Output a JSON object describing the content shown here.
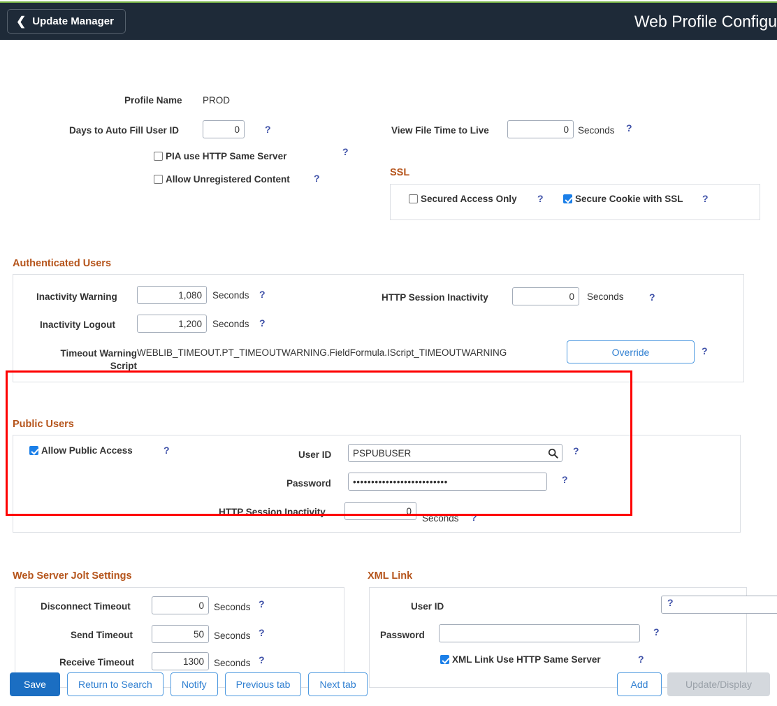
{
  "header": {
    "back_label": "Update Manager",
    "back_icon": "chevron-left-icon",
    "title": "Web Profile Configu"
  },
  "help_glyph": "?",
  "search_glyph": "search-icon",
  "top": {
    "profile_name_label": "Profile Name",
    "profile_name_value": "PROD",
    "days_autofill_label": "Days to Auto Fill User ID",
    "days_autofill_value": "0",
    "pia_http_same_server_label": "PIA use HTTP Same Server",
    "pia_http_same_server_checked": false,
    "allow_unregistered_label": "Allow Unregistered Content",
    "allow_unregistered_checked": false,
    "view_file_ttl_label": "View File Time to Live",
    "view_file_ttl_value": "0",
    "seconds": "Seconds"
  },
  "ssl": {
    "title": "SSL",
    "secured_access_only_label": "Secured Access Only",
    "secured_access_only_checked": false,
    "secure_cookie_label": "Secure Cookie with SSL",
    "secure_cookie_checked": true
  },
  "authenticated_users": {
    "title": "Authenticated Users",
    "inactivity_warning_label": "Inactivity Warning",
    "inactivity_warning_value": "1,080",
    "inactivity_logout_label": "Inactivity Logout",
    "inactivity_logout_value": "1,200",
    "timeout_warning_script_label": "Timeout Warning Script",
    "timeout_warning_script_value": "WEBLIB_TIMEOUT.PT_TIMEOUTWARNING.FieldFormula.IScript_TIMEOUTWARNING",
    "http_session_inactivity_label": "HTTP Session Inactivity",
    "http_session_inactivity_value": "0",
    "override_label": "Override",
    "seconds": "Seconds"
  },
  "public_users": {
    "title": "Public Users",
    "allow_public_access_label": "Allow Public Access",
    "allow_public_access_checked": true,
    "user_id_label": "User ID",
    "user_id_value": "PSPUBUSER",
    "password_label": "Password",
    "password_value": "••••••••••••••••••••••••••",
    "http_session_inactivity_label": "HTTP Session Inactivity",
    "http_session_inactivity_value": "0",
    "seconds": "Seconds"
  },
  "jolt": {
    "title": "Web Server Jolt Settings",
    "disconnect_timeout_label": "Disconnect Timeout",
    "disconnect_timeout_value": "0",
    "send_timeout_label": "Send Timeout",
    "send_timeout_value": "50",
    "receive_timeout_label": "Receive Timeout",
    "receive_timeout_value": "1300",
    "seconds": "Seconds"
  },
  "xml_link": {
    "title": "XML Link",
    "user_id_label": "User ID",
    "user_id_value": "",
    "password_label": "Password",
    "password_value": "",
    "same_server_label": "XML Link Use HTTP Same Server",
    "same_server_checked": true
  },
  "footer": {
    "save": "Save",
    "return_to_search": "Return to Search",
    "notify": "Notify",
    "previous_tab": "Previous tab",
    "next_tab": "Next tab",
    "add": "Add",
    "update_display": "Update/Display"
  },
  "colors": {
    "header_bg": "#1e2a38",
    "accent_green": "#7ab648",
    "group_title": "#b5541b",
    "help_blue": "#3f51a8",
    "primary_blue": "#1b6ec2",
    "checkbox_blue": "#1b7fe8",
    "highlight_red": "#fe0000",
    "disabled_grey": "#d4d8dd"
  }
}
